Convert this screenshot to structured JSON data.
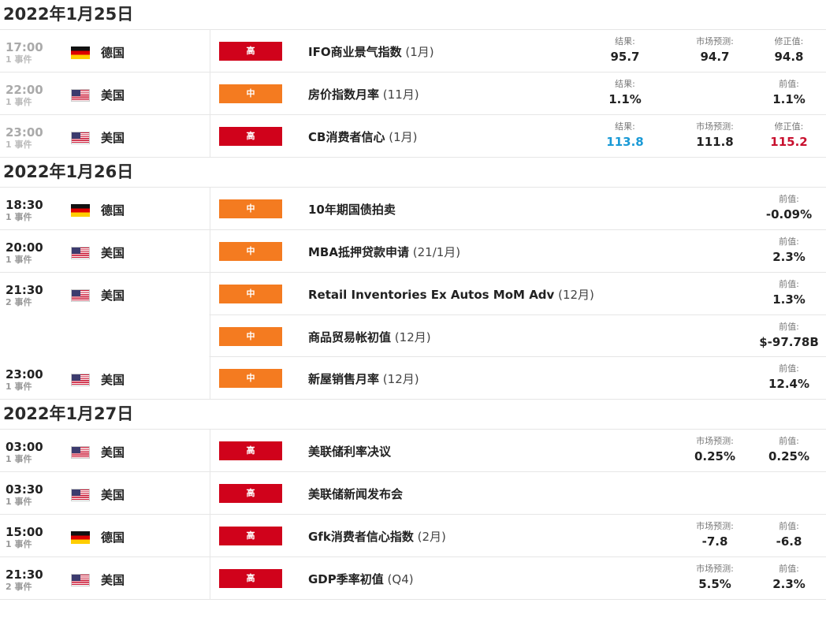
{
  "days": [
    {
      "date": "2022年1月25日",
      "rows": [
        {
          "time": "17:00",
          "events": "1 事件",
          "past": true,
          "flag": "de",
          "country": "德国",
          "impact": "高",
          "impact_level": "high",
          "event": "IFO商业景气指数",
          "period": "(1月)",
          "values": [
            {
              "label": "结果:",
              "value": "95.7",
              "col": 1
            },
            {
              "label": "市场预测:",
              "value": "94.7",
              "col": 2
            },
            {
              "label": "修正值:",
              "value": "94.8",
              "col": 3
            }
          ]
        },
        {
          "time": "22:00",
          "events": "1 事件",
          "past": true,
          "flag": "us",
          "country": "美国",
          "impact": "中",
          "impact_level": "medium",
          "event": "房价指数月率",
          "period": "(11月)",
          "values": [
            {
              "label": "结果:",
              "value": "1.1%",
              "col": 1
            },
            {
              "label": "前值:",
              "value": "1.1%",
              "col": 3
            }
          ]
        },
        {
          "time": "23:00",
          "events": "1 事件",
          "past": true,
          "flag": "us",
          "country": "美国",
          "impact": "高",
          "impact_level": "high",
          "event": "CB消费者信心",
          "period": "(1月)",
          "values": [
            {
              "label": "结果:",
              "value": "113.8",
              "col": 1,
              "color": "blue"
            },
            {
              "label": "市场预测:",
              "value": "111.8",
              "col": 2
            },
            {
              "label": "修正值:",
              "value": "115.2",
              "col": 3,
              "color": "red"
            }
          ]
        }
      ]
    },
    {
      "date": "2022年1月26日",
      "rows": [
        {
          "time": "18:30",
          "events": "1 事件",
          "flag": "de",
          "country": "德国",
          "impact": "中",
          "impact_level": "medium",
          "event": "10年期国债拍卖",
          "period": "",
          "values": [
            {
              "label": "前值:",
              "value": "-0.09%",
              "col": 3
            }
          ]
        },
        {
          "time": "20:00",
          "events": "1 事件",
          "flag": "us",
          "country": "美国",
          "impact": "中",
          "impact_level": "medium",
          "event": "MBA抵押贷款申请",
          "period": "(21/1月)",
          "values": [
            {
              "label": "前值:",
              "value": "2.3%",
              "col": 3
            }
          ]
        },
        {
          "time": "21:30",
          "events": "2 事件",
          "flag": "us",
          "country": "美国",
          "impact": "中",
          "impact_level": "medium",
          "event": "Retail Inventories Ex Autos MoM Adv",
          "period": "(12月)",
          "no_bottom": true,
          "values": [
            {
              "label": "前值:",
              "value": "1.3%",
              "col": 3
            }
          ]
        },
        {
          "time": "",
          "events": "",
          "flag": "",
          "country": "",
          "impact": "中",
          "impact_level": "medium",
          "event": "商品贸易帐初值",
          "period": "(12月)",
          "partial_top": true,
          "values": [
            {
              "label": "前值:",
              "value": "$-97.78B",
              "col": 3
            }
          ]
        },
        {
          "time": "23:00",
          "events": "1 事件",
          "flag": "us",
          "country": "美国",
          "impact": "中",
          "impact_level": "medium",
          "event": "新屋销售月率",
          "period": "(12月)",
          "values": [
            {
              "label": "前值:",
              "value": "12.4%",
              "col": 3
            }
          ]
        }
      ]
    },
    {
      "date": "2022年1月27日",
      "rows": [
        {
          "time": "03:00",
          "events": "1 事件",
          "flag": "us",
          "country": "美国",
          "impact": "高",
          "impact_level": "high",
          "event": "美联储利率决议",
          "period": "",
          "values": [
            {
              "label": "市场预测:",
              "value": "0.25%",
              "col": 2
            },
            {
              "label": "前值:",
              "value": "0.25%",
              "col": 3
            }
          ]
        },
        {
          "time": "03:30",
          "events": "1 事件",
          "flag": "us",
          "country": "美国",
          "impact": "高",
          "impact_level": "high",
          "event": "美联储新闻发布会",
          "period": "",
          "values": []
        },
        {
          "time": "15:00",
          "events": "1 事件",
          "flag": "de",
          "country": "德国",
          "impact": "高",
          "impact_level": "high",
          "event": "Gfk消费者信心指数",
          "period": "(2月)",
          "values": [
            {
              "label": "市场预测:",
              "value": "-7.8",
              "col": 2
            },
            {
              "label": "前值:",
              "value": "-6.8",
              "col": 3
            }
          ]
        },
        {
          "time": "21:30",
          "events": "2 事件",
          "flag": "us",
          "country": "美国",
          "impact": "高",
          "impact_level": "high",
          "event": "GDP季率初值",
          "period": "(Q4)",
          "values": [
            {
              "label": "市场预测:",
              "value": "5.5%",
              "col": 2
            },
            {
              "label": "前值:",
              "value": "2.3%",
              "col": 3
            }
          ]
        }
      ]
    }
  ]
}
